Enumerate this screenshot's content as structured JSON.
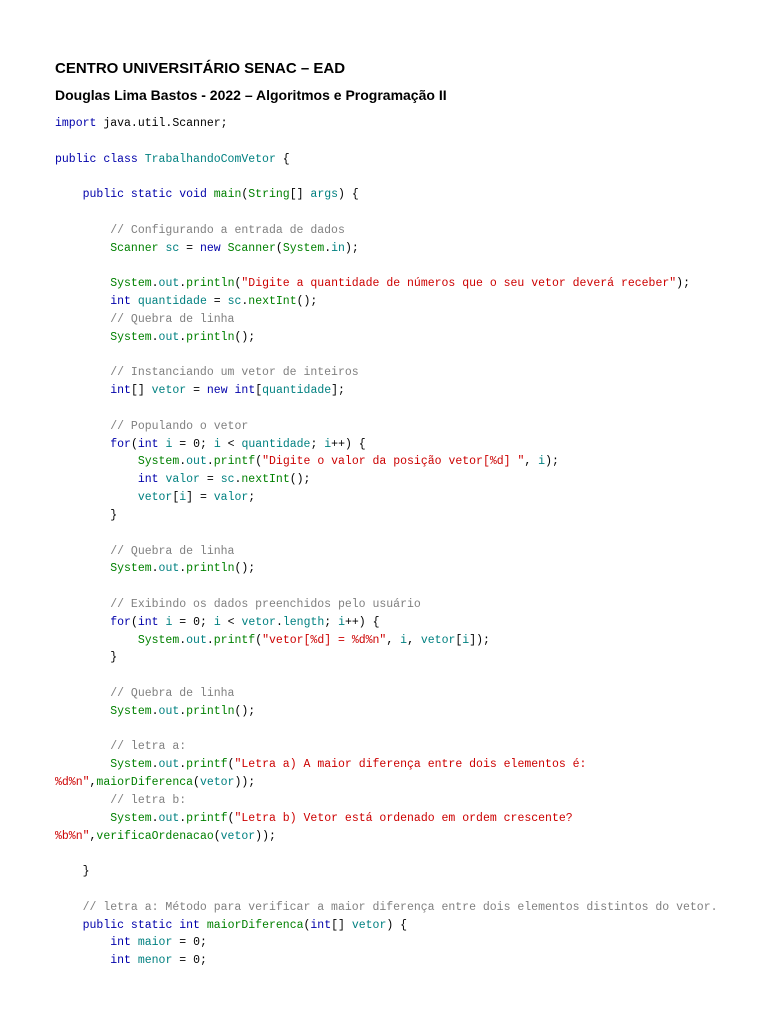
{
  "header": {
    "title1": "CENTRO UNIVERSITÁRIO SENAC – EAD",
    "title2": "Douglas Lima Bastos - 2022 – Algoritmos e Programação II"
  },
  "code": {
    "l1_import": "import",
    "l1_rest": " java.util.Scanner;",
    "l3a": "public",
    "l3b": " class ",
    "l3c": "TrabalhandoComVetor",
    "l3d": " {",
    "l5a": "public",
    "l5b": " static ",
    "l5c": "void",
    "l5d": " ",
    "l5e": "main",
    "l5f": "(",
    "l5g": "String",
    "l5h": "[] ",
    "l5i": "args",
    "l5j": ") {",
    "c1": "// Configurando a entrada de dados",
    "l7a": "Scanner",
    "l7b": " ",
    "l7c": "sc",
    "l7d": " = ",
    "l7e": "new",
    "l7f": " ",
    "l7g": "Scanner",
    "l7h": "(",
    "l7i": "System",
    "l7j": ".",
    "l7k": "in",
    "l7l": ");",
    "l9a": "System",
    "l9b": ".",
    "l9c": "out",
    "l9d": ".",
    "l9e": "println",
    "l9f": "(",
    "l9g": "\"Digite a quantidade de números que o seu vetor deverá receber\"",
    "l9h": ");",
    "l10a": "int",
    "l10b": " ",
    "l10c": "quantidade",
    "l10d": " = ",
    "l10e": "sc",
    "l10f": ".",
    "l10g": "nextInt",
    "l10h": "();",
    "c2": "// Quebra de linha",
    "l12a": "System",
    "l12b": ".",
    "l12c": "out",
    "l12d": ".",
    "l12e": "println",
    "l12f": "();",
    "c3": "// Instanciando um vetor de inteiros",
    "l14a": "int",
    "l14b": "[] ",
    "l14c": "vetor",
    "l14d": " = ",
    "l14e": "new",
    "l14f": " ",
    "l14g": "int",
    "l14h": "[",
    "l14i": "quantidade",
    "l14j": "];",
    "c4": "// Populando o vetor",
    "l16a": "for",
    "l16b": "(",
    "l16c": "int",
    "l16d": " ",
    "l16e": "i",
    "l16f": " = ",
    "l16g": "0",
    "l16h": "; ",
    "l16i": "i",
    "l16j": " < ",
    "l16k": "quantidade",
    "l16l": "; ",
    "l16m": "i",
    "l16n": "++) {",
    "l17a": "System",
    "l17b": ".",
    "l17c": "out",
    "l17d": ".",
    "l17e": "printf",
    "l17f": "(",
    "l17g": "\"Digite o valor da posição vetor[%d] \"",
    "l17h": ", ",
    "l17i": "i",
    "l17j": ");",
    "l18a": "int",
    "l18b": " ",
    "l18c": "valor",
    "l18d": " = ",
    "l18e": "sc",
    "l18f": ".",
    "l18g": "nextInt",
    "l18h": "();",
    "l19a": "vetor",
    "l19b": "[",
    "l19c": "i",
    "l19d": "] = ",
    "l19e": "valor",
    "l19f": ";",
    "l20": "}",
    "c5": "// Quebra de linha",
    "l22a": "System",
    "l22b": ".",
    "l22c": "out",
    "l22d": ".",
    "l22e": "println",
    "l22f": "();",
    "c6": "// Exibindo os dados preenchidos pelo usuário",
    "l24a": "for",
    "l24b": "(",
    "l24c": "int",
    "l24d": " ",
    "l24e": "i",
    "l24f": " = ",
    "l24g": "0",
    "l24h": "; ",
    "l24i": "i",
    "l24j": " < ",
    "l24k": "vetor",
    "l24l": ".",
    "l24m": "length",
    "l24n": "; ",
    "l24o": "i",
    "l24p": "++) {",
    "l25a": "System",
    "l25b": ".",
    "l25c": "out",
    "l25d": ".",
    "l25e": "printf",
    "l25f": "(",
    "l25g": "\"vetor[%d] = %d%n\"",
    "l25h": ", ",
    "l25i": "i",
    "l25j": ", ",
    "l25k": "vetor",
    "l25l": "[",
    "l25m": "i",
    "l25n": "]);",
    "l26": "}",
    "c7": "// Quebra de linha",
    "l28a": "System",
    "l28b": ".",
    "l28c": "out",
    "l28d": ".",
    "l28e": "println",
    "l28f": "();",
    "c8": "// letra a:",
    "l30a": "System",
    "l30b": ".",
    "l30c": "out",
    "l30d": ".",
    "l30e": "printf",
    "l30f": "(",
    "l30g": "\"Letra a) A maior diferença entre dois elementos é:",
    "l31a": "%d%n\"",
    "l31b": ",",
    "l31c": "maiorDiferenca",
    "l31d": "(",
    "l31e": "vetor",
    "l31f": "));",
    "c9": "// letra b:",
    "l33a": "System",
    "l33b": ".",
    "l33c": "out",
    "l33d": ".",
    "l33e": "printf",
    "l33f": "(",
    "l33g": "\"Letra b) Vetor está ordenado em ordem crescente?",
    "l34a": "%b%n\"",
    "l34b": ",",
    "l34c": "verificaOrdenacao",
    "l34d": "(",
    "l34e": "vetor",
    "l34f": "));",
    "l35": "}",
    "c10": "// letra a: Método para verificar a maior diferença entre dois elementos distintos do vetor.",
    "l37a": "public",
    "l37b": " static ",
    "l37c": "int",
    "l37d": " ",
    "l37e": "maiorDiferenca",
    "l37f": "(",
    "l37g": "int",
    "l37h": "[] ",
    "l37i": "vetor",
    "l37j": ") {",
    "l38a": "int",
    "l38b": " ",
    "l38c": "maior",
    "l38d": " = ",
    "l38e": "0",
    "l38f": ";",
    "l39a": "int",
    "l39b": " ",
    "l39c": "menor",
    "l39d": " = ",
    "l39e": "0",
    "l39f": ";"
  }
}
